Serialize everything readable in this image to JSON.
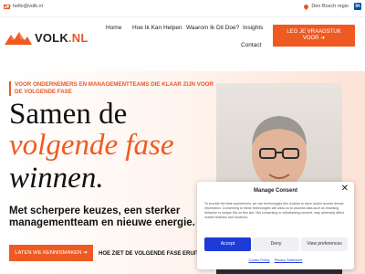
{
  "topbar": {
    "email": "hello@volk.nl",
    "region": "Den Bosch regio",
    "linkedin_glyph": "in"
  },
  "header": {
    "logo_text": "VOLK",
    "logo_suffix": ".NL",
    "nav": [
      "Home",
      "Hoe Ik Kan Helpen",
      "Waarom Ik Dit Doe?",
      "Insights",
      "Contact"
    ],
    "cta_line1": "LEG JE VRAAGSTUK",
    "cta_line2": "VOOR"
  },
  "hero": {
    "eyebrow": "VOOR ONDERNEMERS EN MANAGEMENTTEAMS DIE KLAAR ZIJN VOOR DE VOLGENDE FASE",
    "heading_line1": "Samen de",
    "heading_line2": "volgende fase",
    "heading_line3": "winnen.",
    "subheading": "Met scherpere keuzes, een sterker managementteam en nieuwe energie.",
    "primary_button": "LATEN WE KENNISMAKEN",
    "secondary_link": "HOE ZIET DE VOLGENDE FASE ERUIT?"
  },
  "consent": {
    "title": "Manage Consent",
    "body": "To provide the best experiences, we use technologies like cookies to store and/or access device information. Consenting to these technologies will allow us to process data such as browsing behavior or unique IDs on this site. Not consenting or withdrawing consent, may adversely affect certain features and functions.",
    "accept": "Accept",
    "deny": "Deny",
    "preferences": "View preferences",
    "cookie_policy": "Cookie Policy",
    "privacy_statement": "Privacy Statement"
  },
  "colors": {
    "brand": "#ef5a22",
    "consent_accept": "#1e3bd8",
    "linkedin": "#0a4da2"
  },
  "icons": {
    "mail": "mail-icon",
    "location": "map-pin-icon",
    "linkedin": "linkedin-icon",
    "arrow": "arrow-right-icon",
    "close": "close-icon"
  }
}
